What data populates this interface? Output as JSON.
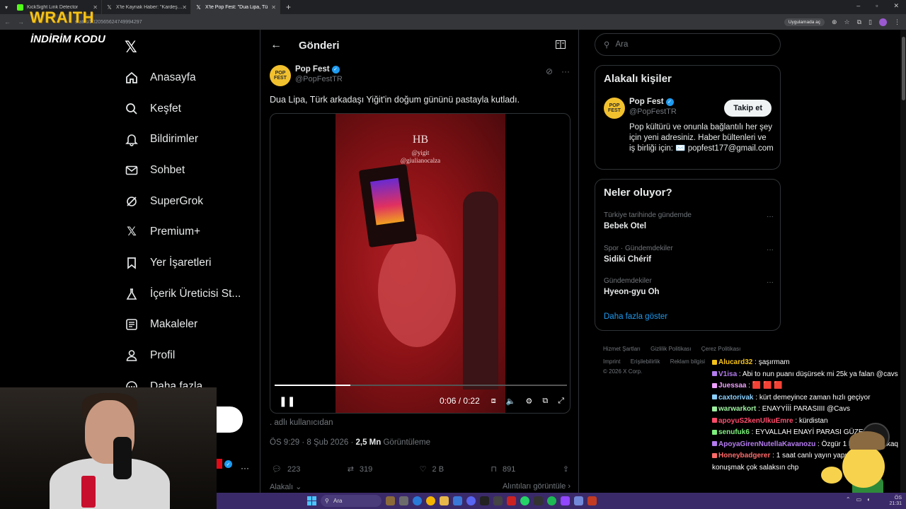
{
  "browser": {
    "tabs": [
      {
        "label": "KickSight Link Detector",
        "active": false
      },
      {
        "label": "X'te Kaynak Haber: \"Kardeşinin",
        "active": false
      },
      {
        "label": "X'te Pop Fest: \"Dua Lipa, Tü",
        "active": true
      }
    ],
    "url": "status/2020565624749994297",
    "app_pill": "Uygulamada aç"
  },
  "overlay": {
    "brand": "WRAITH",
    "brand_sub": "İNDİRİM KODU"
  },
  "nav": {
    "items": [
      {
        "label": "Anasayfa",
        "icon": "home-icon"
      },
      {
        "label": "Keşfet",
        "icon": "search-icon"
      },
      {
        "label": "Bildirimler",
        "icon": "bell-icon"
      },
      {
        "label": "Sohbet",
        "icon": "mail-icon"
      },
      {
        "label": "SuperGrok",
        "icon": "grok-icon"
      },
      {
        "label": "Premium+",
        "icon": "x-icon"
      },
      {
        "label": "Yer İşaretleri",
        "icon": "bookmark-icon"
      },
      {
        "label": "İçerik Üreticisi St...",
        "icon": "flask-icon"
      },
      {
        "label": "Makaleler",
        "icon": "article-icon"
      },
      {
        "label": "Profil",
        "icon": "person-icon"
      },
      {
        "label": "Daha fazla",
        "icon": "more-icon"
      }
    ]
  },
  "post": {
    "header_title": "Gönderi",
    "author_name": "Pop Fest",
    "author_handle": "@PopFestTR",
    "avatar_text": "POP FEST",
    "text": "Dua Lipa, Türk arkadaşı Yiğit'in doğum gününü pastayla kutladı.",
    "video_overlay_title": "HB",
    "video_overlay_line1": "@yigit",
    "video_overlay_line2": "@giulianocalza",
    "time_current": "0:06",
    "time_total": "0:22",
    "progress": 0.26,
    "from_user": "adlı kullanıcıdan",
    "from_prefix": ".",
    "timestamp": "ÖS 9:29 · 8 Şub 2026 ·",
    "views_value": "2,5 Mn",
    "views_label": "Görüntüleme",
    "replies": "223",
    "reposts": "319",
    "likes": "2 B",
    "bookmarks": "891",
    "relevant_label": "Alakalı",
    "quotes_label": "Alıntıları görüntüle"
  },
  "sidebar": {
    "search_placeholder": "Ara",
    "related_title": "Alakalı kişiler",
    "related_name": "Pop Fest",
    "related_handle": "@PopFestTR",
    "follow_label": "Takip et",
    "bio": "Pop kültürü ve onunla bağlantılı her şey için yeni adresiniz. Haber bültenleri ve iş birliği için: ✉️ popfest177@gmail.com",
    "trends_title": "Neler oluyor?",
    "trends": [
      {
        "context": "Türkiye tarihinde gündemde",
        "title": "Bebek Otel"
      },
      {
        "context": "Spor · Gündemdekiler",
        "title": "Sidiki Chérif"
      },
      {
        "context": "Gündemdekiler",
        "title": "Hyeon-gyu Oh"
      }
    ],
    "show_more": "Daha fazla göster",
    "footer_line1": [
      "Hizmet Şartları",
      "Gizlilik Politikası",
      "Çerez Politikası"
    ],
    "footer_line2": [
      "Imprint",
      "Erişilebilirlik",
      "Reklam bilgisi"
    ],
    "copyright": "© 2026 X Corp."
  },
  "chat": [
    {
      "user": "Alucard32",
      "msg": "şaşırmam",
      "color": "#f4c21a"
    },
    {
      "user": "V1isa",
      "msg": "Abi to nun puanı düşürsek mi 25k ya falan @cavs",
      "color": "#b57cf0"
    },
    {
      "user": "Juessaa",
      "msg": "🟥 🟥 🟥",
      "color": "#f0a0ff"
    },
    {
      "user": "caxtorivak",
      "msg": "kürt demeyince zaman hızlı geçiyor",
      "color": "#8ad0ff"
    },
    {
      "user": "warwarkort",
      "msg": "ENAYYİİİ PARASIIII @Cavs",
      "color": "#9ef0a0"
    },
    {
      "user": "apoyuS2kenUlkuEmre",
      "msg": "kürdistan",
      "color": "#ff4b6b"
    },
    {
      "user": "senufuk6",
      "msg": "EYVALLAH ENAYİ PARASI GÜZELDİ",
      "color": "#7cf07c"
    },
    {
      "user": "ApoyaGirenNutellaKavanozu",
      "msg": "Özgür 1 kerecik yarakaq",
      "color": "#b57cf0"
    },
    {
      "user": "Honeybadgerer",
      "msg": "1 saat canlı yayın yapıp 5 dakika konuşmak çok salaksın chp",
      "color": "#ff6a6a"
    }
  ],
  "taskbar": {
    "search": "Ara",
    "clock_time": "21:31",
    "clock_label": "ÖS"
  },
  "colors": {
    "accent": "#1d9bf0",
    "brand_yellow": "#f4c21a",
    "taskbar": "#3b2a6a"
  }
}
